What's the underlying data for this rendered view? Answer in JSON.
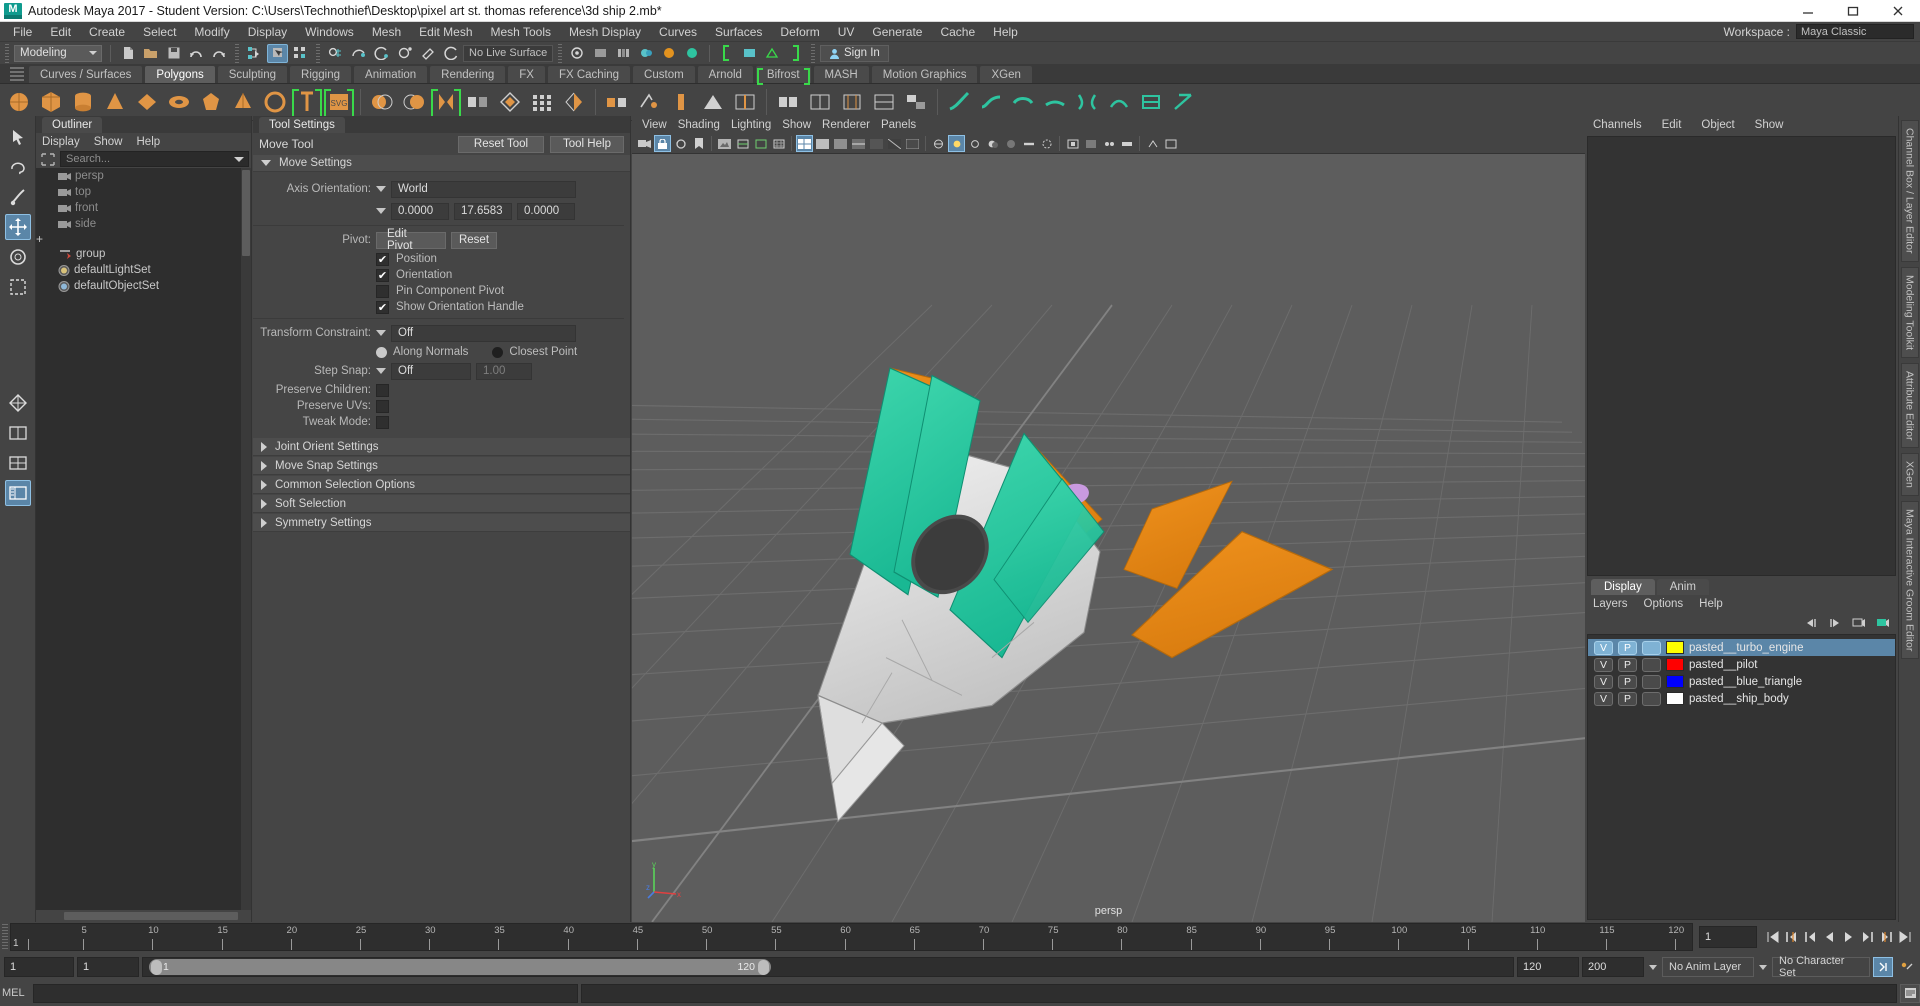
{
  "window": {
    "title": "Autodesk Maya 2017 - Student Version: C:\\Users\\Technothief\\Desktop\\pixel art st. thomas reference\\3d ship 2.mb*",
    "logo_text": "M",
    "minimize": "minimize-icon",
    "maximize": "maximize-icon",
    "close": "close-icon"
  },
  "menubar": {
    "items": [
      "File",
      "Edit",
      "Create",
      "Select",
      "Modify",
      "Display",
      "Windows",
      "Mesh",
      "Edit Mesh",
      "Mesh Tools",
      "Mesh Display",
      "Curves",
      "Surfaces",
      "Deform",
      "UV",
      "Generate",
      "Cache",
      "Help"
    ],
    "workspace_label": "Workspace :",
    "workspace_value": "Maya Classic"
  },
  "statusbar": {
    "mode": "Modeling",
    "live_surface": "No Live Surface",
    "signin": "Sign In"
  },
  "shelf": {
    "tabs": [
      "Curves / Surfaces",
      "Polygons",
      "Sculpting",
      "Rigging",
      "Animation",
      "Rendering",
      "FX",
      "FX Caching",
      "Custom",
      "Arnold",
      "Bifrost",
      "MASH",
      "Motion Graphics",
      "XGen"
    ],
    "active_tab": "Polygons",
    "bracketed_tab": "Bifrost"
  },
  "outliner": {
    "tab": "Outliner",
    "menus": [
      "Display",
      "Show",
      "Help"
    ],
    "search_placeholder": "Search...",
    "items": [
      {
        "label": "persp",
        "icon": "camera-icon",
        "dim": true,
        "expandable": false
      },
      {
        "label": "top",
        "icon": "camera-icon",
        "dim": true,
        "expandable": false
      },
      {
        "label": "front",
        "icon": "camera-icon",
        "dim": true,
        "expandable": false
      },
      {
        "label": "side",
        "icon": "camera-icon",
        "dim": true,
        "expandable": false
      },
      {
        "label": "group",
        "icon": "transform-icon",
        "dim": false,
        "expandable": true
      },
      {
        "label": "defaultLightSet",
        "icon": "set-icon",
        "dim": false,
        "expandable": false
      },
      {
        "label": "defaultObjectSet",
        "icon": "set-icon",
        "dim": false,
        "expandable": false
      }
    ]
  },
  "toolsettings": {
    "tab": "Tool Settings",
    "tool_name": "Move Tool",
    "reset_tool": "Reset Tool",
    "tool_help": "Tool Help",
    "move_settings_title": "Move Settings",
    "axis_orientation_label": "Axis Orientation:",
    "axis_orientation_value": "World",
    "axis_x": "0.0000",
    "axis_y": "17.6583",
    "axis_z": "0.0000",
    "pivot_label": "Pivot:",
    "edit_pivot": "Edit Pivot",
    "reset": "Reset",
    "checks": [
      {
        "label": "Position",
        "checked": true
      },
      {
        "label": "Orientation",
        "checked": true
      },
      {
        "label": "Pin Component Pivot",
        "checked": false
      },
      {
        "label": "Show Orientation Handle",
        "checked": true
      }
    ],
    "transform_constraint_label": "Transform Constraint:",
    "transform_constraint_value": "Off",
    "along_normals": "Along Normals",
    "closest_point": "Closest Point",
    "step_snap_label": "Step Snap:",
    "step_snap_value": "Off",
    "step_snap_amount": "1.00",
    "preserve_children_label": "Preserve Children:",
    "preserve_uvs_label": "Preserve UVs:",
    "tweak_mode_label": "Tweak Mode:",
    "sections": [
      "Joint Orient Settings",
      "Move Snap Settings",
      "Common Selection Options",
      "Soft Selection",
      "Symmetry Settings"
    ]
  },
  "viewport": {
    "menus": [
      "View",
      "Shading",
      "Lighting",
      "Show",
      "Renderer",
      "Panels"
    ],
    "camera_label": "persp",
    "axis_x": "x",
    "axis_y": "y",
    "axis_z": "z",
    "bg_color": "#5d5d5d",
    "grid_color": "#6c6c6c"
  },
  "channelbox": {
    "menus": [
      "Channels",
      "Edit",
      "Object",
      "Show"
    ]
  },
  "layers": {
    "tabs": [
      "Display",
      "Anim"
    ],
    "active_tab": "Display",
    "menus": [
      "Layers",
      "Options",
      "Help"
    ],
    "visibility_flag": "V",
    "playback_flag": "P",
    "rows": [
      {
        "name": "pasted__turbo_engine",
        "color": "#ffff00",
        "selected": true
      },
      {
        "name": "pasted__pilot",
        "color": "#ff0000",
        "selected": false
      },
      {
        "name": "pasted__blue_triangle",
        "color": "#0000ff",
        "selected": false
      },
      {
        "name": "pasted__ship_body",
        "color": "#ffffff",
        "selected": false
      }
    ]
  },
  "rightstrip": {
    "tabs": [
      "Channel Box / Layer Editor",
      "Modeling Toolkit",
      "Attribute Editor",
      "XGen",
      "Maya Interactive Groom Editor"
    ]
  },
  "timeline": {
    "current_frame": "1",
    "ticks": [
      1,
      5,
      10,
      15,
      20,
      25,
      30,
      35,
      40,
      45,
      50,
      55,
      60,
      65,
      70,
      75,
      80,
      85,
      90,
      95,
      100,
      105,
      110,
      115,
      120
    ],
    "frame_field": "1",
    "start_field": "1",
    "anim_start": "1",
    "range_start_label": "1",
    "range_end_label": "120",
    "playback_end": "120",
    "anim_end": "200",
    "anim_layer": "No Anim Layer",
    "character_set": "No Character Set"
  },
  "mel": {
    "label": "MEL"
  }
}
